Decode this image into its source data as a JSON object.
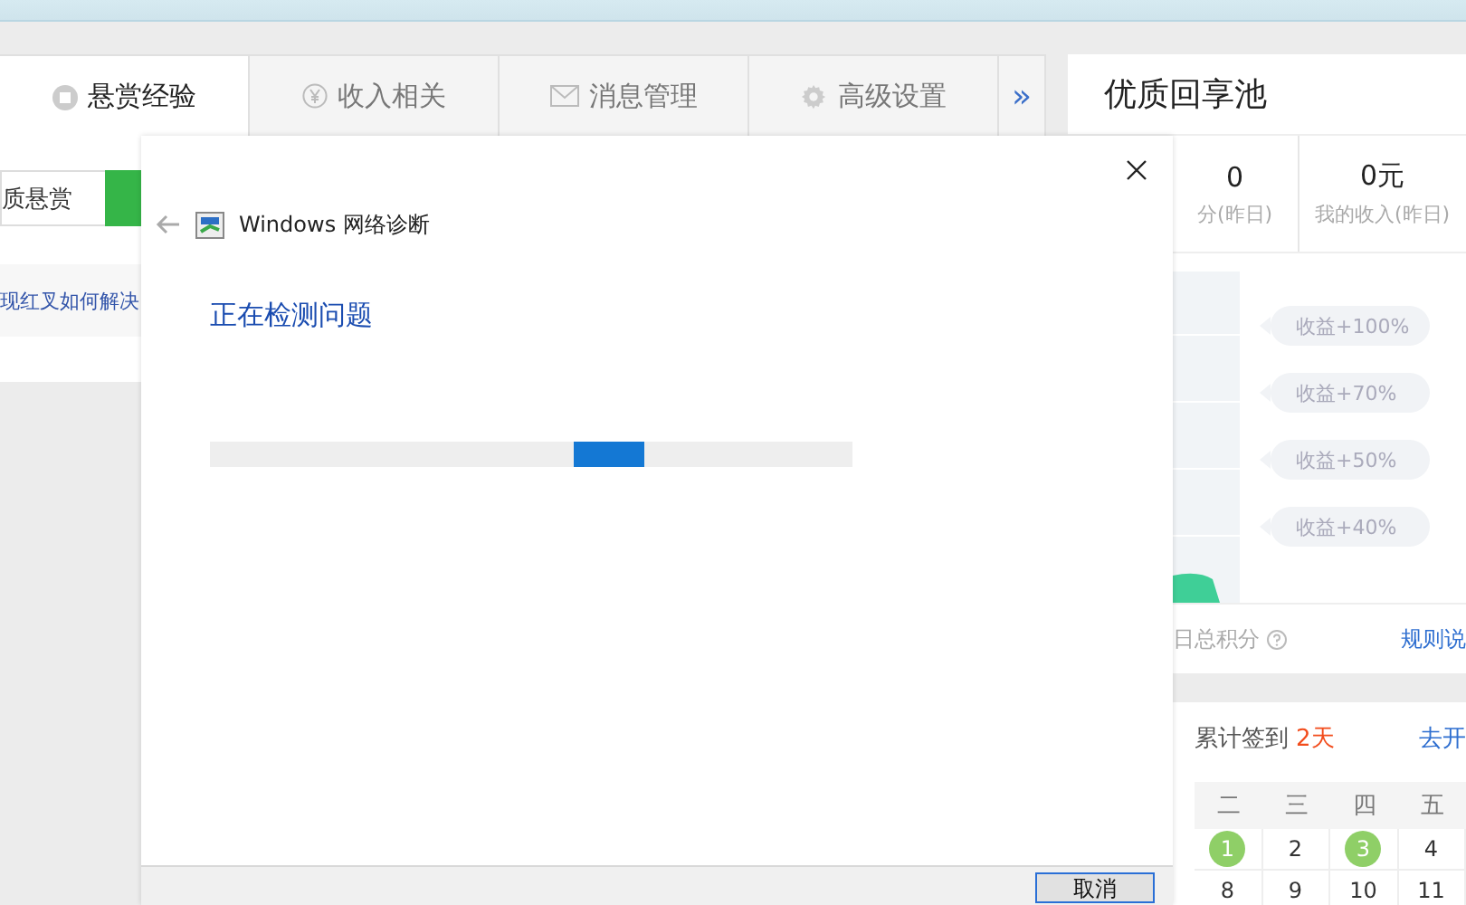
{
  "page": {
    "tabs": [
      {
        "label": "悬赏经验",
        "kind": "reward",
        "selected": true
      },
      {
        "label": "收入相关",
        "kind": "yen",
        "selected": false
      },
      {
        "label": "消息管理",
        "kind": "mail",
        "selected": false
      },
      {
        "label": "高级设置",
        "kind": "gear",
        "selected": false
      }
    ],
    "more_tabs": "»",
    "search": {
      "value": "质悬赏"
    },
    "question_item": "现红叉如何解决",
    "pool": {
      "title": "优质回享池",
      "stats": [
        {
          "value": "0",
          "label": "分(昨日)"
        },
        {
          "value": "0元",
          "label": "我的收入(昨日)"
        }
      ],
      "bonuses": [
        "收益+100%",
        "收益+70%",
        "收益+50%",
        "收益+40%"
      ],
      "total_label": "日总积分",
      "rules_link": "规则说"
    },
    "sign_in": {
      "label": "累计签到",
      "count": "2天",
      "link": "去开",
      "weekdays": [
        "二",
        "三",
        "四",
        "五"
      ],
      "weeks": [
        [
          {
            "day": "1",
            "signed": true
          },
          {
            "day": "2",
            "signed": false
          },
          {
            "day": "3",
            "signed": true
          },
          {
            "day": "4",
            "signed": false
          }
        ],
        [
          {
            "day": "8",
            "signed": false
          },
          {
            "day": "9",
            "signed": false
          },
          {
            "day": "10",
            "signed": false
          },
          {
            "day": "11",
            "signed": false
          }
        ]
      ]
    }
  },
  "dialog": {
    "title": "Windows 网络诊断",
    "status": "正在检测问题",
    "progress": {
      "indeterminate": true
    },
    "cancel_button": "取消"
  }
}
